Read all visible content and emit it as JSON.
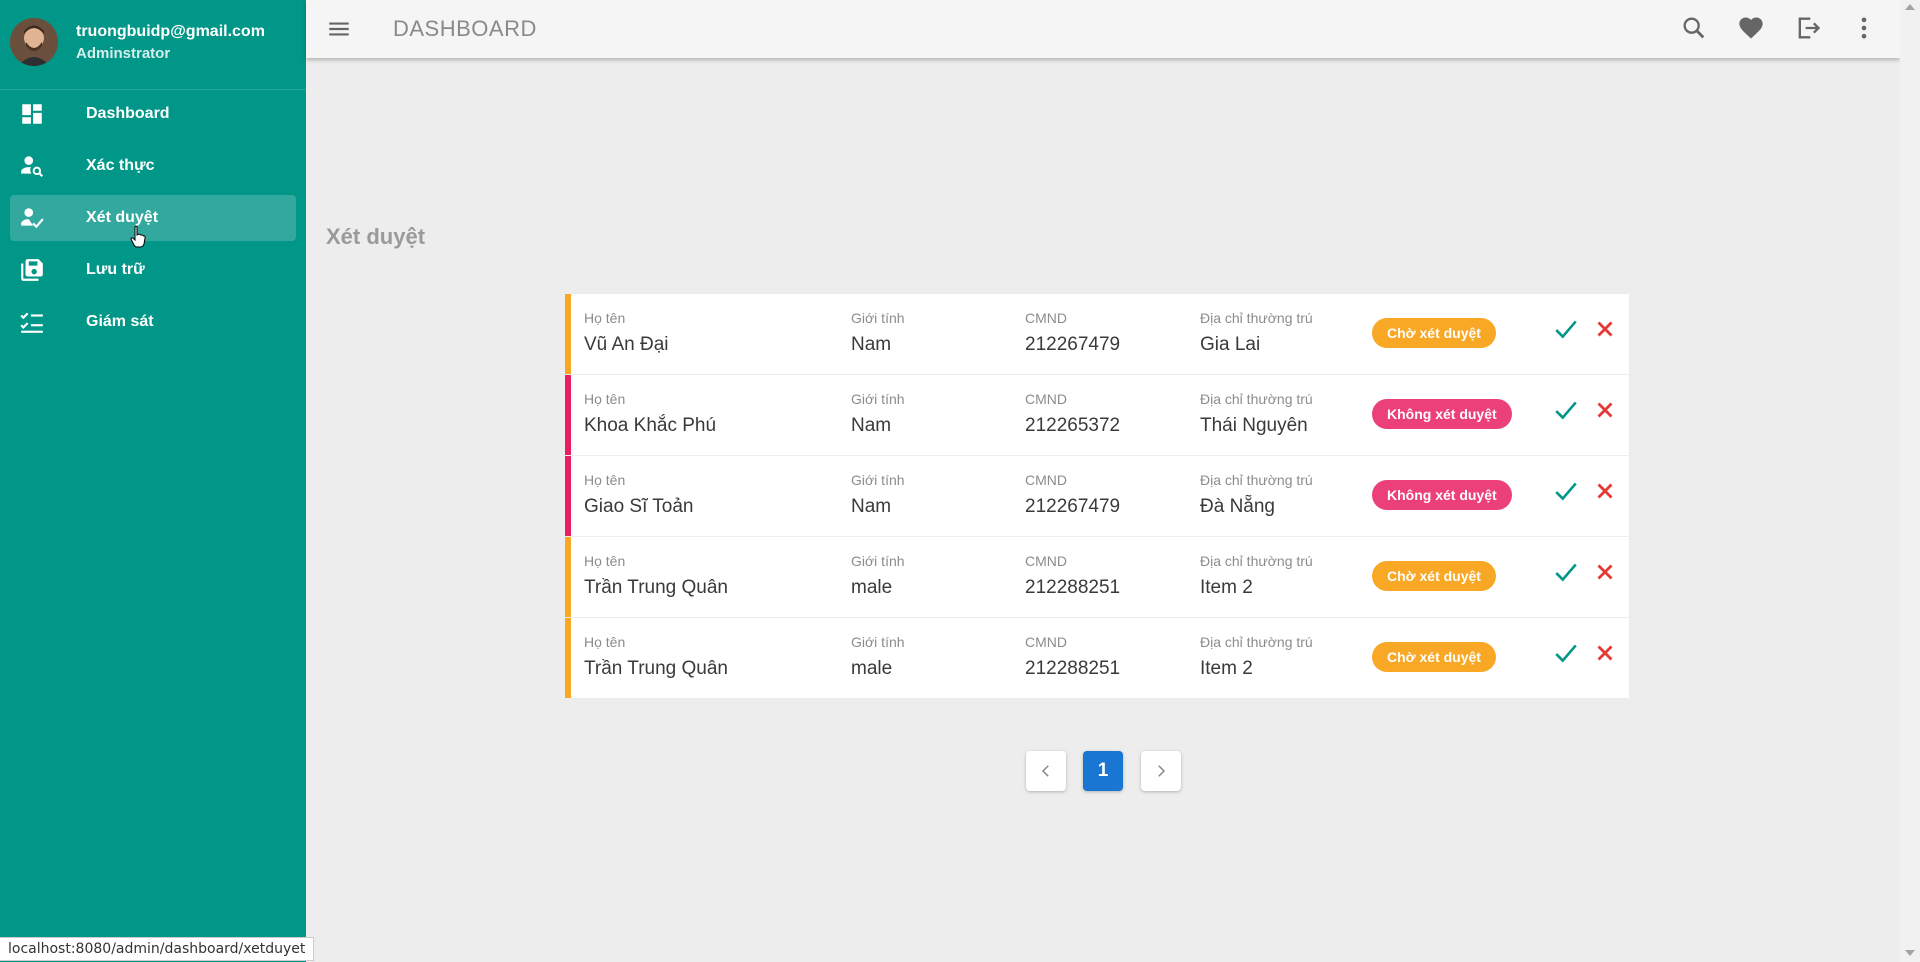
{
  "user": {
    "email": "truongbuidp@gmail.com",
    "role": "Adminstrator"
  },
  "sidebar": {
    "items": [
      {
        "label": "Dashboard",
        "icon": "dashboard-icon"
      },
      {
        "label": "Xác thực",
        "icon": "person-search-icon"
      },
      {
        "label": "Xét duyệt",
        "icon": "person-check-icon",
        "active": true
      },
      {
        "label": "Lưu trữ",
        "icon": "save-archive-icon"
      },
      {
        "label": "Giám sát",
        "icon": "checklist-icon"
      }
    ]
  },
  "header": {
    "title": "DASHBOARD",
    "icons": [
      "menu-icon",
      "search-icon",
      "heart-icon",
      "logout-icon",
      "more-vert-icon"
    ]
  },
  "section": {
    "title": "Xét duyệt"
  },
  "columns": {
    "name": "Họ tên",
    "gender": "Giới tính",
    "cmnd": "CMND",
    "address": "Địa chỉ thường trú"
  },
  "rows": [
    {
      "name": "Vũ An Đại",
      "gender": "Nam",
      "cmnd": "212267479",
      "address": "Gia Lai",
      "status": "Chờ xét duyệt",
      "status_type": "pending"
    },
    {
      "name": "Khoa Khắc Phú",
      "gender": "Nam",
      "cmnd": "212265372",
      "address": "Thái Nguyên",
      "status": "Không xét duyệt",
      "status_type": "rejected"
    },
    {
      "name": "Giao Sĩ Toản",
      "gender": "Nam",
      "cmnd": "212267479",
      "address": "Đà Nẵng",
      "status": "Không xét duyệt",
      "status_type": "rejected"
    },
    {
      "name": "Trần Trung Quân",
      "gender": "male",
      "cmnd": "212288251",
      "address": "Item 2",
      "status": "Chờ xét duyệt",
      "status_type": "pending"
    },
    {
      "name": "Trần Trung Quân",
      "gender": "male",
      "cmnd": "212288251",
      "address": "Item 2",
      "status": "Chờ xét duyệt",
      "status_type": "pending"
    }
  ],
  "pagination": {
    "current": "1"
  },
  "colors": {
    "sidebar": "#009688",
    "pending": "#f9a825",
    "rejected": "#e91e63",
    "approve": "#009688",
    "reject": "#e53935",
    "page_active": "#1976d2"
  },
  "status_bar": {
    "url": "localhost:8080/admin/dashboard/xetduyet"
  }
}
